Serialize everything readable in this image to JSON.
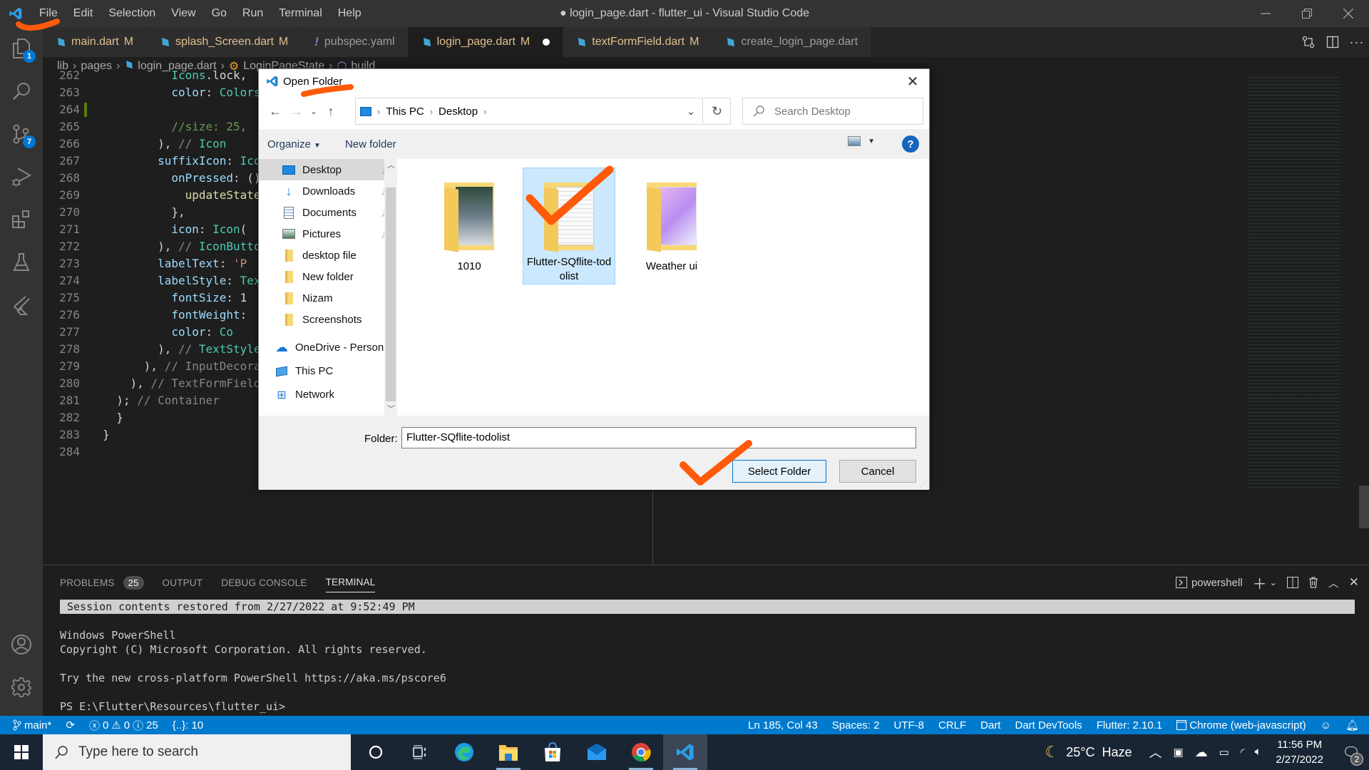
{
  "window": {
    "title": "● login_page.dart - flutter_ui - Visual Studio Code",
    "menu": [
      "File",
      "Edit",
      "Selection",
      "View",
      "Go",
      "Run",
      "Terminal",
      "Help"
    ],
    "controls": {
      "minimize": "minimize-icon",
      "restore": "restore-icon",
      "close": "close-icon"
    }
  },
  "activity_bar": {
    "items": [
      {
        "name": "explorer",
        "icon": "files-icon",
        "badge": "1"
      },
      {
        "name": "search",
        "icon": "search-icon",
        "badge": null
      },
      {
        "name": "source-control",
        "icon": "source-control-icon",
        "badge": "7"
      },
      {
        "name": "run-debug",
        "icon": "run-debug-icon",
        "badge": null
      },
      {
        "name": "extensions",
        "icon": "extensions-icon",
        "badge": null
      },
      {
        "name": "testing",
        "icon": "flask-icon",
        "badge": null
      },
      {
        "name": "flutter",
        "icon": "flutter-icon",
        "badge": null
      }
    ],
    "bottom": [
      {
        "name": "accounts",
        "icon": "account-icon"
      },
      {
        "name": "manage",
        "icon": "gear-icon"
      }
    ]
  },
  "tabs": [
    {
      "label": "main.dart",
      "modified": "M",
      "active": false,
      "icon": "dart-icon",
      "plain": false
    },
    {
      "label": "splash_Screen.dart",
      "modified": "M",
      "active": false,
      "icon": "dart-icon",
      "plain": false
    },
    {
      "label": "pubspec.yaml",
      "modified": "",
      "active": false,
      "icon": "yaml-icon",
      "plain": true
    },
    {
      "label": "login_page.dart",
      "modified": "M",
      "active": true,
      "icon": "dart-icon",
      "plain": false,
      "unsaved": true
    },
    {
      "label": "textFormField.dart",
      "modified": "M",
      "active": false,
      "icon": "dart-icon",
      "plain": false
    },
    {
      "label": "create_login_page.dart",
      "modified": "",
      "active": false,
      "icon": "dart-icon",
      "plain": true
    }
  ],
  "breadcrumb": [
    "lib",
    "pages",
    "login_page.dart",
    "LoginPageState",
    "build"
  ],
  "editor": {
    "lines": [
      {
        "n": "262",
        "code": "          Icons.lock,"
      },
      {
        "n": "263",
        "code": "          color: Colors"
      },
      {
        "n": "264",
        "code": ""
      },
      {
        "n": "265",
        "code": "          //size: 25,"
      },
      {
        "n": "266",
        "code": "        ), // Icon"
      },
      {
        "n": "267",
        "code": "        suffixIcon: IconButton("
      },
      {
        "n": "268",
        "code": "          onPressed: () {"
      },
      {
        "n": "269",
        "code": "            updateState"
      },
      {
        "n": "270",
        "code": "          },"
      },
      {
        "n": "271",
        "code": "          icon: Icon("
      },
      {
        "n": "272",
        "code": "        ), // IconButton"
      },
      {
        "n": "273",
        "code": "        labelText: 'P"
      },
      {
        "n": "274",
        "code": "        labelStyle: TextStyle("
      },
      {
        "n": "275",
        "code": "          fontSize: 1"
      },
      {
        "n": "276",
        "code": "          fontWeight:"
      },
      {
        "n": "277",
        "code": "          color: Co"
      },
      {
        "n": "278",
        "code": "        ), // TextStyle"
      },
      {
        "n": "279",
        "code": "      ), // InputDecoration"
      },
      {
        "n": "280",
        "code": "    ), // TextFormField"
      },
      {
        "n": "281",
        "code": "  ); // Container"
      },
      {
        "n": "282",
        "code": "  }"
      },
      {
        "n": "283",
        "code": "}"
      },
      {
        "n": "284",
        "code": ""
      }
    ]
  },
  "panel": {
    "tabs": [
      {
        "label": "PROBLEMS",
        "badge": "25",
        "active": false
      },
      {
        "label": "OUTPUT",
        "active": false
      },
      {
        "label": "DEBUG CONSOLE",
        "active": false
      },
      {
        "label": "TERMINAL",
        "active": true
      }
    ],
    "shell_label": "powershell",
    "terminal": {
      "restored": "Session contents restored from 2/27/2022 at 9:52:49 PM",
      "lines": [
        "",
        "Windows PowerShell",
        "Copyright (C) Microsoft Corporation. All rights reserved.",
        "",
        "Try the new cross-platform PowerShell https://aka.ms/pscore6",
        "",
        "PS E:\\Flutter\\Resources\\flutter_ui>"
      ]
    }
  },
  "status_bar": {
    "branch": "main*",
    "errors": "0",
    "warnings": "0",
    "infos": "25",
    "symbols": "{..}: 10",
    "position": "Ln 185, Col 43",
    "spaces": "Spaces: 2",
    "encoding": "UTF-8",
    "eol": "CRLF",
    "language": "Dart",
    "devtools": "Dart DevTools",
    "flutter": "Flutter: 2.10.1",
    "device": "Chrome (web-javascript)",
    "color": "#007acc"
  },
  "dialog": {
    "title": "Open Folder",
    "address": [
      "This PC",
      "Desktop"
    ],
    "search_placeholder": "Search Desktop",
    "toolbar": {
      "organize": "Organize",
      "new_folder": "New folder"
    },
    "nav_items": [
      {
        "label": "Desktop",
        "icon": "desktop-icon",
        "pinned": true,
        "selected": true
      },
      {
        "label": "Downloads",
        "icon": "download-icon",
        "pinned": true
      },
      {
        "label": "Documents",
        "icon": "documents-icon",
        "pinned": true
      },
      {
        "label": "Pictures",
        "icon": "pictures-icon",
        "pinned": true
      },
      {
        "label": "desktop file",
        "icon": "folder-icon"
      },
      {
        "label": "New folder",
        "icon": "folder-icon"
      },
      {
        "label": "Nizam",
        "icon": "folder-icon"
      },
      {
        "label": "Screenshots",
        "icon": "folder-icon"
      },
      {
        "label": "OneDrive - Person",
        "icon": "onedrive-icon"
      },
      {
        "label": "This PC",
        "icon": "this-pc-icon"
      },
      {
        "label": "Network",
        "icon": "network-icon"
      }
    ],
    "files": [
      {
        "label": "1010",
        "selected": false,
        "thumb": "photo"
      },
      {
        "label": "Flutter-SQflite-todolist",
        "selected": true,
        "thumb": "docs"
      },
      {
        "label": "Weather ui",
        "selected": false,
        "thumb": "app"
      }
    ],
    "folder_label": "Folder:",
    "folder_value": "Flutter-SQflite-todolist",
    "select_button": "Select Folder",
    "cancel_button": "Cancel"
  },
  "taskbar": {
    "search_placeholder": "Type here to search",
    "apps": [
      "cortana-icon",
      "task-view-icon",
      "edge-icon",
      "file-explorer-icon",
      "store-icon",
      "mail-icon",
      "chrome-icon",
      "vscode-icon"
    ],
    "weather": "25°C  Haze",
    "time": "11:56 PM",
    "date": "2/27/2022",
    "notifications": "2"
  },
  "annotation_color": "#ff5a0a"
}
